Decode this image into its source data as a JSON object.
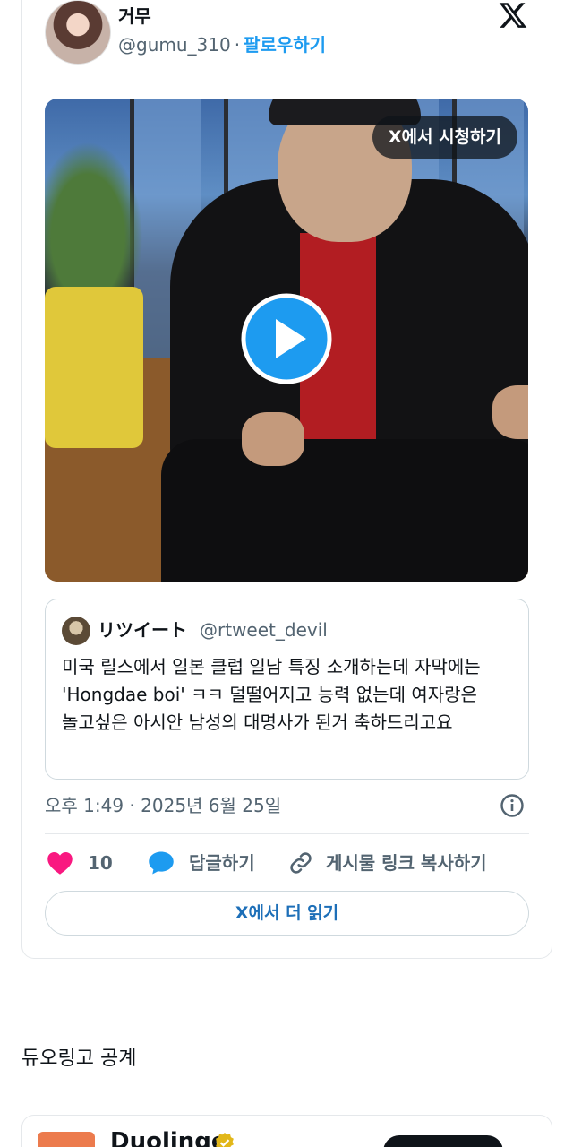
{
  "tweet": {
    "author": {
      "name": "거무",
      "handle": "@gumu_310",
      "separator": "·",
      "follow_label": "팔로우하기"
    },
    "brand_icon": "x-logo-icon",
    "video": {
      "watch_on_x_label": "X에서 시청하기",
      "play_icon": "play-icon"
    },
    "quoted": {
      "name": "リツイート",
      "handle": "@rtweet_devil",
      "text": "미국 릴스에서 일본 클럽 일남 특징 소개하는데 자막에는 'Hongdae boi' ㅋㅋ  덜떨어지고 능력 없는데 여자랑은 놀고싶은 아시안 남성의 대명사가 된거 축하드리고요"
    },
    "timestamp": "오후 1:49 · 2025년 6월 25일",
    "actions": {
      "like_count": "10",
      "reply_label": "답글하기",
      "copy_link_label": "게시물 링크 복사하기"
    },
    "read_more_label": "X에서 더 읽기"
  },
  "section": {
    "title": "듀오링고 공계"
  },
  "next_card": {
    "name": "Duolingo"
  },
  "colors": {
    "accent": "#1d9bf0",
    "like": "#f91880",
    "muted_text": "#536471"
  }
}
